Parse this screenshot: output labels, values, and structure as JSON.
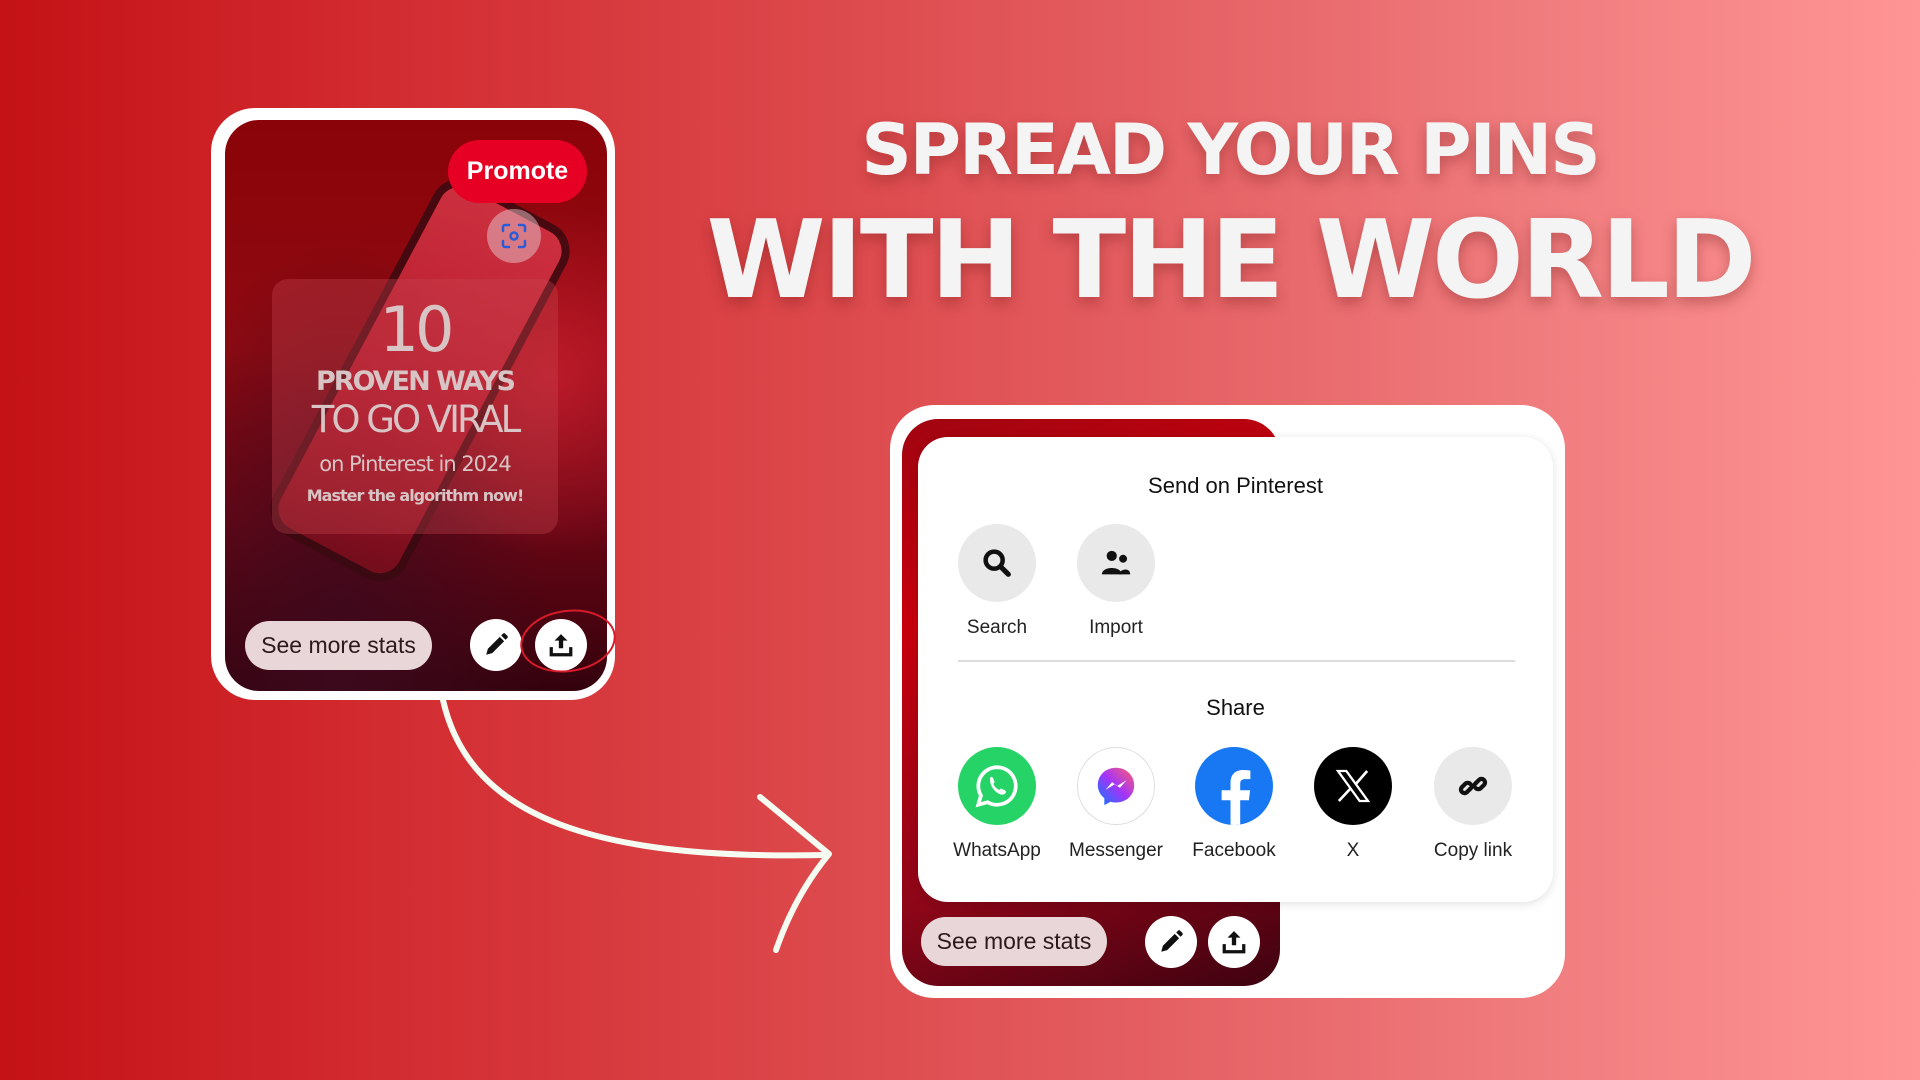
{
  "headline": {
    "line1": "SPREAD YOUR PINS",
    "line2": "WITH THE WORLD"
  },
  "pin_card": {
    "promote_label": "Promote",
    "visual_search_icon": "lens-scan-icon",
    "overlay_text": {
      "number": "10",
      "line2": "PROVEN WAYS",
      "line3": "TO GO VIRAL",
      "line4": "on Pinterest in 2024",
      "line5": "Master the algorithm now!"
    },
    "stats_label": "See more stats",
    "edit_icon": "pencil-icon",
    "share_icon": "upload-share-icon",
    "share_highlighted": true
  },
  "share_popup": {
    "title": "Send on Pinterest",
    "send_options": [
      {
        "label": "Search",
        "icon": "search-icon"
      },
      {
        "label": "Import",
        "icon": "people-icon"
      }
    ],
    "share_heading": "Share",
    "share_options": [
      {
        "label": "WhatsApp",
        "icon": "whatsapp-icon",
        "color": "#25D366"
      },
      {
        "label": "Messenger",
        "icon": "messenger-icon",
        "color": "#A334FA"
      },
      {
        "label": "Facebook",
        "icon": "facebook-icon",
        "color": "#1877F2"
      },
      {
        "label": "X",
        "icon": "x-icon",
        "color": "#000000"
      },
      {
        "label": "Copy link",
        "icon": "link-icon",
        "color": "#E9E9E9"
      }
    ],
    "stats_label": "See more stats"
  },
  "colors": {
    "pinterest_red": "#E60023",
    "background_left": "#C41216",
    "background_right": "#FF9595"
  }
}
